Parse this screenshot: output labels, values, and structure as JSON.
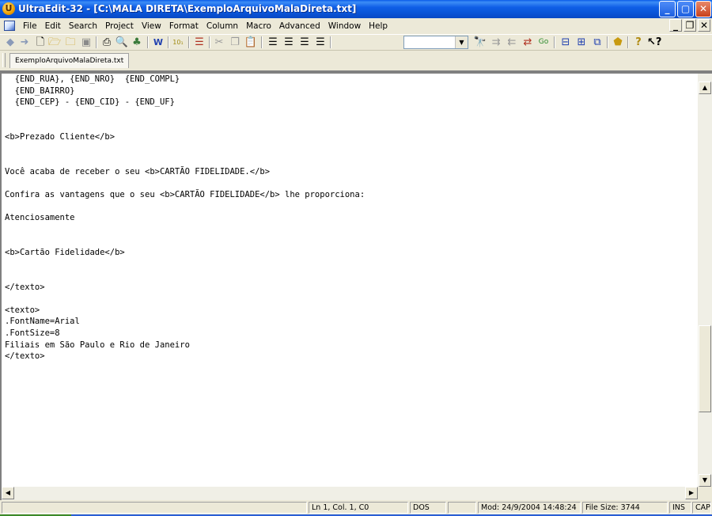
{
  "window": {
    "title": "UltraEdit-32 - [C:\\MALA DIRETA\\ExemploArquivoMalaDireta.txt]",
    "app_icon": "ultraedit-logo-icon",
    "controls": {
      "minimize": "_",
      "maximize": "▢",
      "close": "✕"
    }
  },
  "menu": {
    "items": [
      "File",
      "Edit",
      "Search",
      "Project",
      "View",
      "Format",
      "Column",
      "Macro",
      "Advanced",
      "Window",
      "Help"
    ],
    "mdi": {
      "minimize": "_",
      "restore": "❐",
      "close": "✕"
    }
  },
  "toolbar": {
    "icons": [
      "back-arrow-icon",
      "forward-arrow-icon",
      "new-file-icon",
      "open-folder-icon",
      "open-icon",
      "save-icon",
      "print-icon",
      "print-preview-icon",
      "spell-check-icon",
      "word-wrap-icon",
      "hex-icon",
      "column-icon",
      "cut-icon",
      "copy-icon",
      "paste-icon",
      "align-left-icon",
      "align-center-icon",
      "align-right-icon",
      "justify-icon",
      "find-icon",
      "find-next-icon",
      "find-prev-icon",
      "replace-icon",
      "goto-icon",
      "split-horizontal-icon",
      "split-vertical-icon",
      "window-icon",
      "tag-icon",
      "help-icon",
      "context-help-icon"
    ],
    "combo_value": ""
  },
  "tabs": [
    {
      "label": "ExemploArquivoMalaDireta.txt",
      "active": true
    }
  ],
  "editor": {
    "lines": [
      "  {END_RUA}, {END_NRO}  {END_COMPL}",
      "  {END_BAIRRO}",
      "  {END_CEP} - {END_CID} - {END_UF}",
      "",
      "",
      "<b>Prezado Cliente</b>",
      "",
      "",
      "Você acaba de receber o seu <b>CARTÃO FIDELIDADE.</b>",
      "",
      "Confira as vantagens que o seu <b>CARTÃO FIDELIDADE</b> lhe proporciona:",
      "",
      "Atenciosamente",
      "",
      "",
      "<b>Cartão Fidelidade</b>",
      "",
      "",
      "</texto>",
      "",
      "<texto>",
      ".FontName=Arial",
      ".FontSize=8",
      "Filiais em São Paulo e Rio de Janeiro",
      "</texto>"
    ]
  },
  "status": {
    "position": "Ln 1, Col. 1, C0",
    "format": "DOS",
    "modified": "Mod: 24/9/2004 14:48:24",
    "file_size": "File Size: 3744",
    "insert_mode": "INS",
    "caps": "CAP"
  }
}
